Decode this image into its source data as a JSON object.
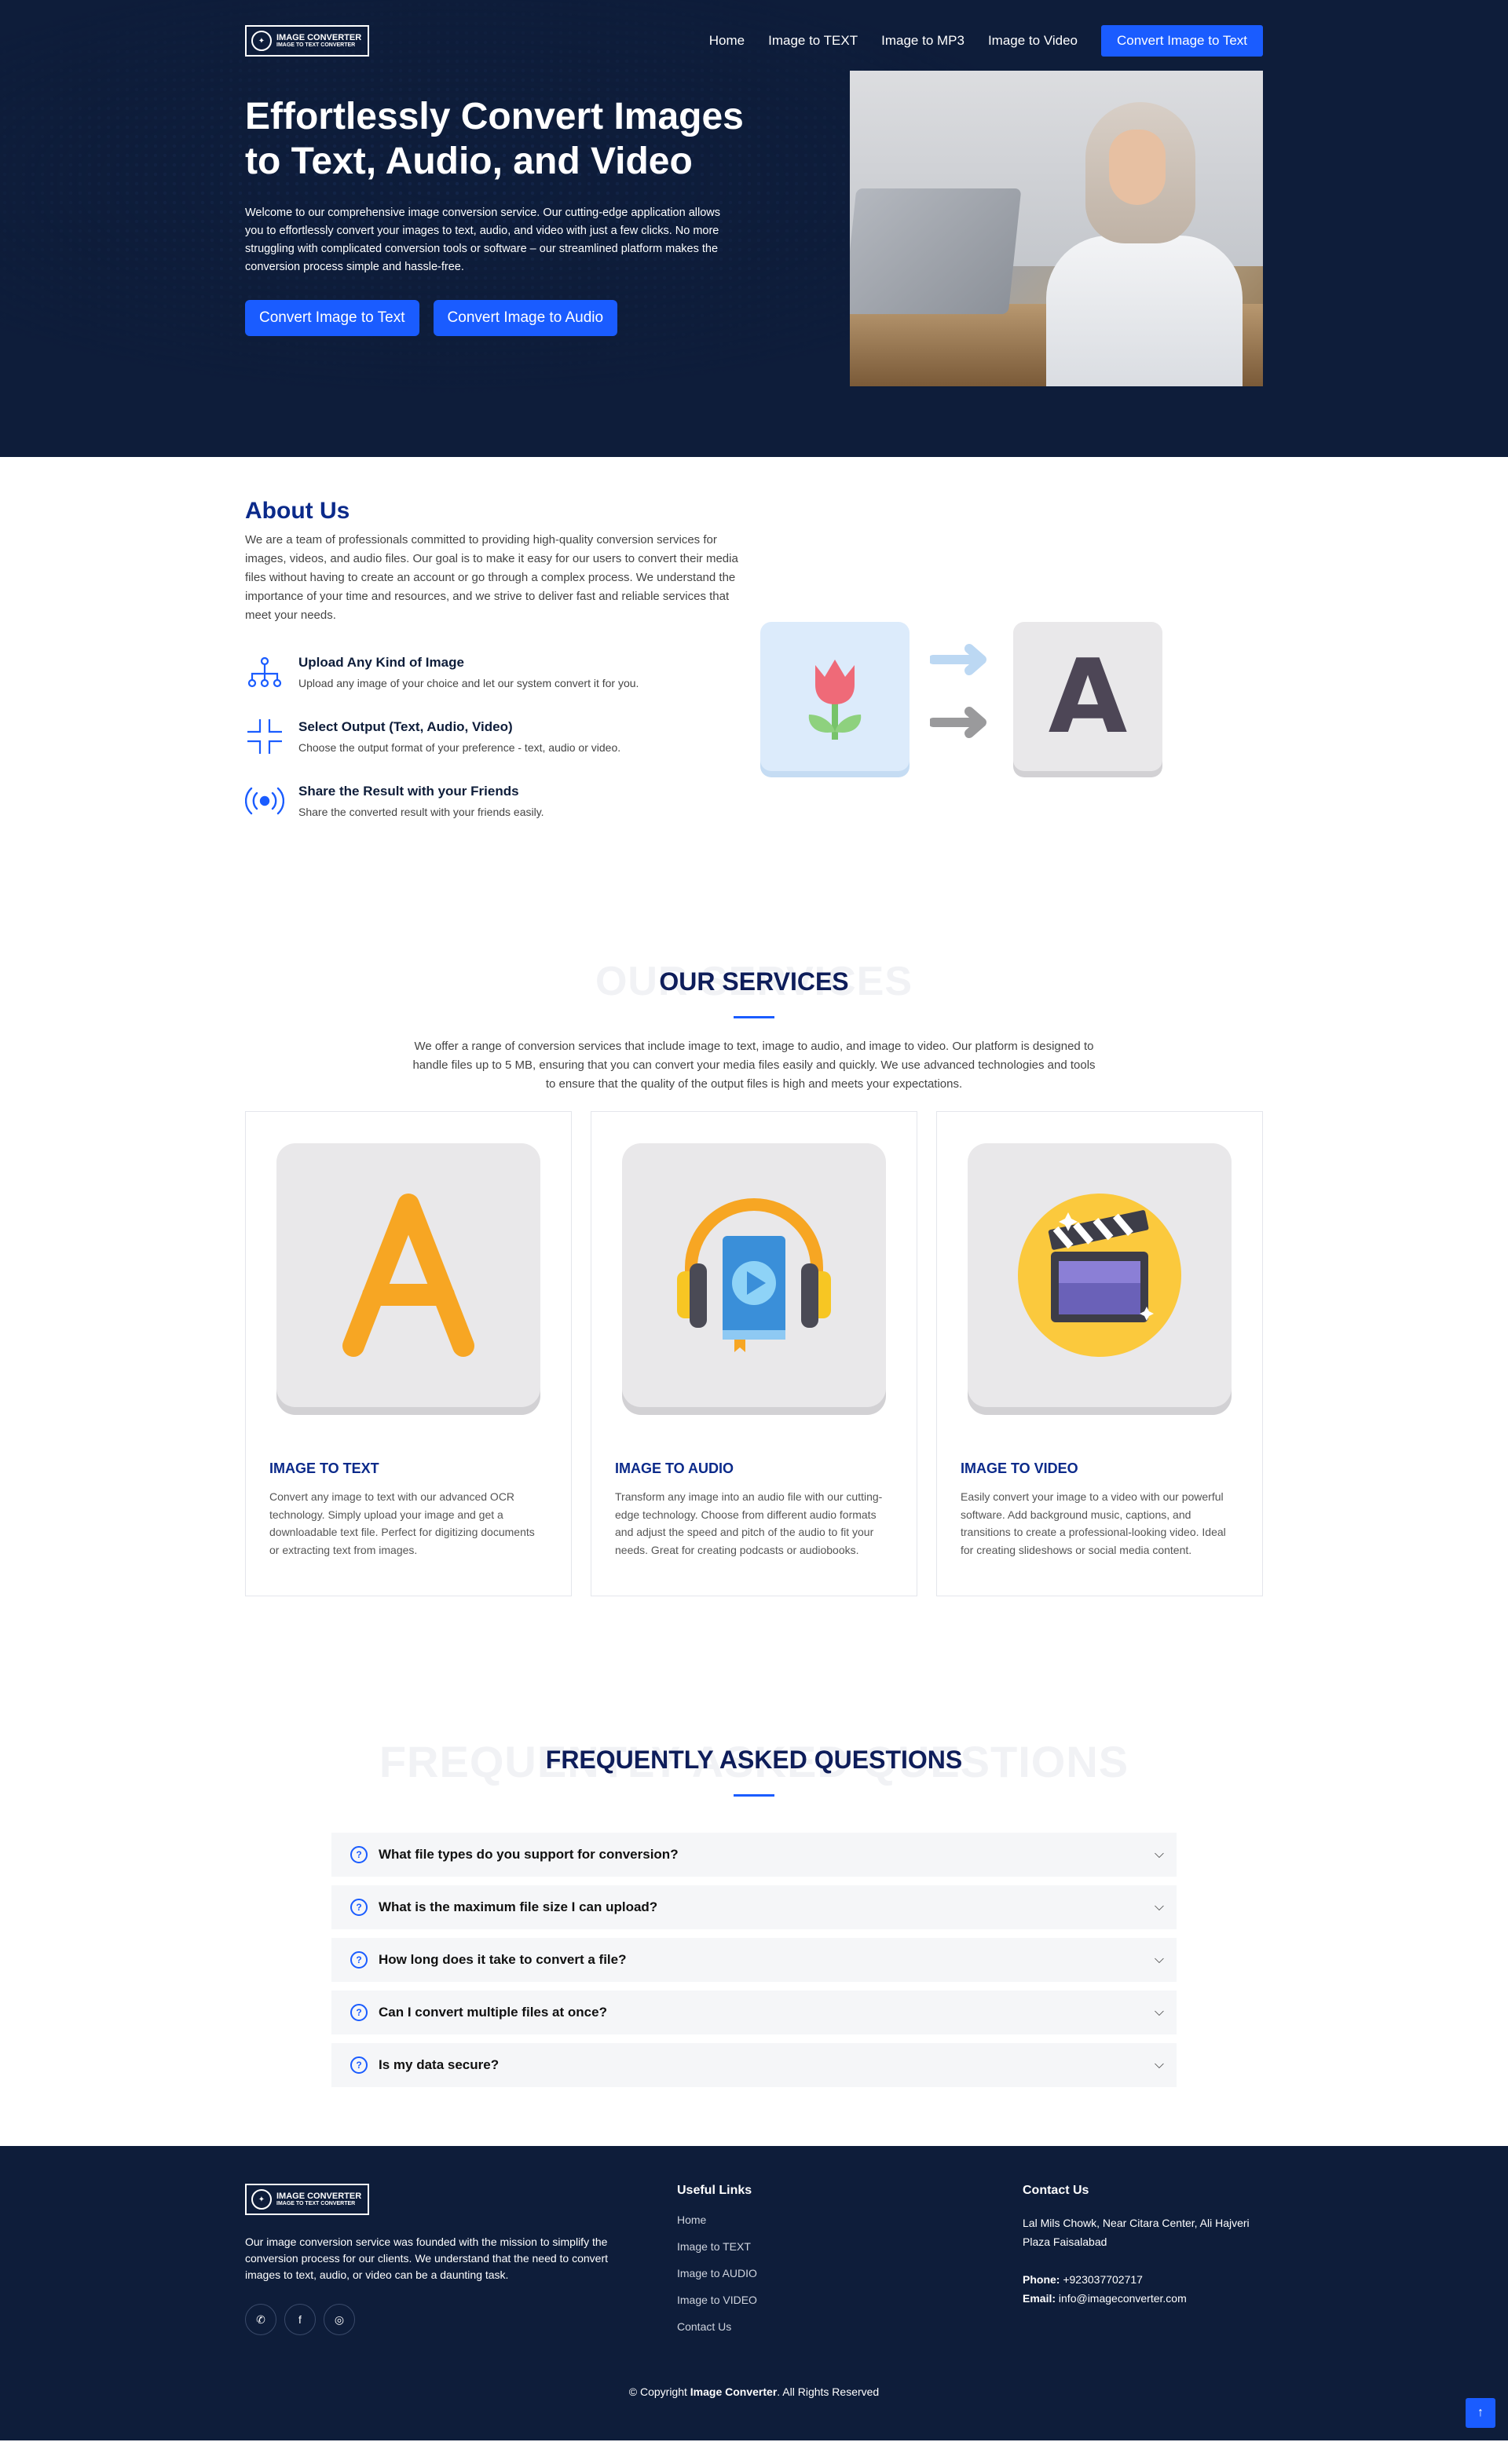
{
  "nav": {
    "logo_title": "IMAGE CONVERTER",
    "logo_sub": "IMAGE TO TEXT CONVERTER",
    "links": [
      "Home",
      "Image to TEXT",
      "Image to MP3",
      "Image to Video"
    ],
    "cta": "Convert Image to Text"
  },
  "hero": {
    "title": "Effortlessly Convert Images to Text, Audio, and Video",
    "text": "Welcome to our comprehensive image conversion service. Our cutting-edge application allows you to effortlessly convert your images to text, audio, and video with just a few clicks. No more struggling with complicated conversion tools or software – our streamlined platform makes the conversion process simple and hassle-free.",
    "btn1": "Convert Image to Text",
    "btn2": "Convert Image to Audio"
  },
  "about": {
    "title": "About Us",
    "text": "We are a team of professionals committed to providing high-quality conversion services for images, videos, and audio files. Our goal is to make it easy for our users to convert their media files without having to create an account or go through a complex process. We understand the importance of your time and resources, and we strive to deliver fast and reliable services that meet your needs.",
    "features": [
      {
        "title": "Upload Any Kind of Image",
        "text": "Upload any image of your choice and let our system convert it for you.",
        "icon": "sitemap-icon"
      },
      {
        "title": "Select Output (Text, Audio, Video)",
        "text": "Choose the output format of your preference - text, audio or video.",
        "icon": "fullscreen-exit-icon"
      },
      {
        "title": "Share the Result with your Friends",
        "text": "Share the converted result with your friends easily.",
        "icon": "broadcast-icon"
      }
    ],
    "art_letter": "A"
  },
  "services": {
    "ghost": "OUR SERVICES",
    "title": "OUR SERVICES",
    "text": "We offer a range of conversion services that include image to text, image to audio, and image to video. Our platform is designed to handle files up to 5 MB, ensuring that you can convert your media files easily and quickly. We use advanced technologies and tools to ensure that the quality of the output files is high and meets your expectations.",
    "cards": [
      {
        "title": "IMAGE TO TEXT",
        "text": "Convert any image to text with our advanced OCR technology. Simply upload your image and get a downloadable text file. Perfect for digitizing documents or extracting text from images.",
        "letter": "A"
      },
      {
        "title": "IMAGE TO AUDIO",
        "text": "Transform any image into an audio file with our cutting-edge technology. Choose from different audio formats and adjust the speed and pitch of the audio to fit your needs. Great for creating podcasts or audiobooks."
      },
      {
        "title": "IMAGE TO VIDEO",
        "text": "Easily convert your image to a video with our powerful software. Add background music, captions, and transitions to create a professional-looking video. Ideal for creating slideshows or social media content."
      }
    ]
  },
  "faq": {
    "ghost": "FREQUENTLY ASKED QUESTIONS",
    "title": "FREQUENTLY ASKED QUESTIONS",
    "items": [
      "What file types do you support for conversion?",
      "What is the maximum file size I can upload?",
      "How long does it take to convert a file?",
      "Can I convert multiple files at once?",
      "Is my data secure?"
    ]
  },
  "footer": {
    "about": "Our image conversion service was founded with the mission to simplify the conversion process for our clients. We understand that the need to convert images to text, audio, or video can be a daunting task.",
    "links_title": "Useful Links",
    "links": [
      "Home",
      "Image to TEXT",
      "Image to AUDIO",
      "Image to VIDEO",
      "Contact Us"
    ],
    "contact_title": "Contact Us",
    "address": "Lal Mils Chowk, Near Citara Center, Ali Hajveri Plaza Faisalabad",
    "phone_label": "Phone:",
    "phone": "+923037702717",
    "email_label": "Email:",
    "email": "info@imageconverter.com",
    "copyright_pre": "© Copyright ",
    "copyright_brand": "Image Converter",
    "copyright_post": ". All Rights Reserved"
  }
}
